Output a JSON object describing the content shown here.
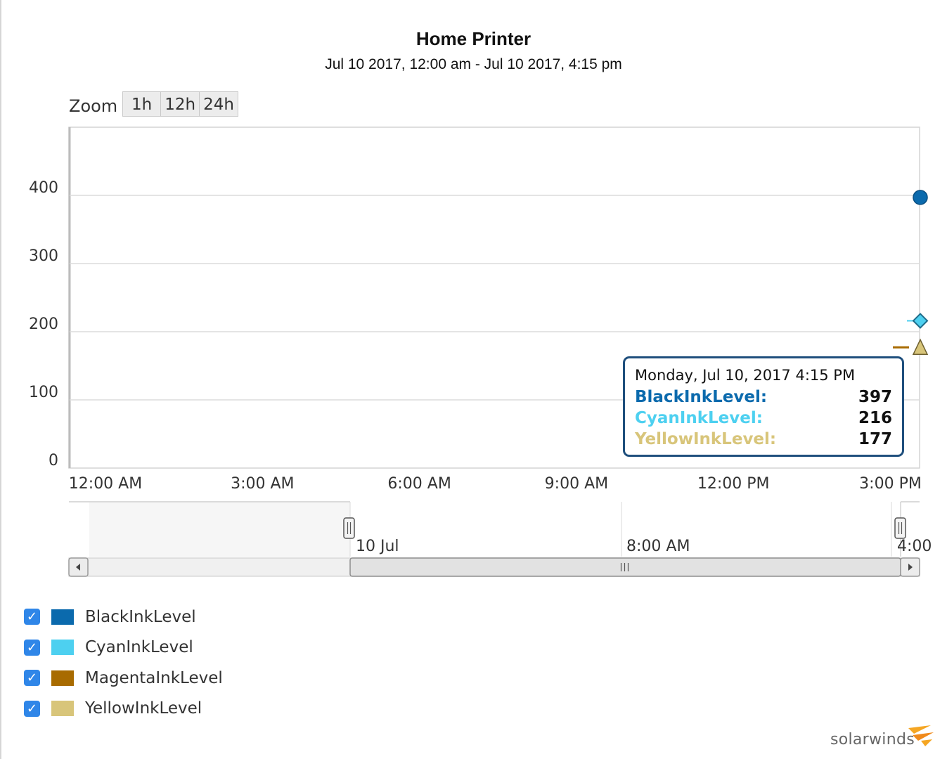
{
  "title": "Home Printer",
  "subtitle": "Jul 10 2017, 12:00 am - Jul 10 2017, 4:15 pm",
  "zoom": {
    "label": "Zoom",
    "buttons": [
      "1h",
      "12h",
      "24h"
    ]
  },
  "chart_data": {
    "type": "line",
    "title": "Home Printer",
    "subtitle": "Jul 10 2017, 12:00 am - Jul 10 2017, 4:15 pm",
    "xlabel": "",
    "ylabel": "",
    "x_range": [
      "12:00 AM",
      "4:15 PM"
    ],
    "x_tick_labels": [
      "12:00 AM",
      "3:00 AM",
      "6:00 AM",
      "9:00 AM",
      "12:00 PM",
      "3:00 PM"
    ],
    "ylim": [
      0,
      400
    ],
    "y_ticks": [
      0,
      100,
      200,
      300,
      400
    ],
    "grid": true,
    "series": [
      {
        "name": "BlackInkLevel",
        "color": "#0b6aad",
        "marker": "circle",
        "points": [
          {
            "x": "4:15 PM",
            "y": 397
          }
        ]
      },
      {
        "name": "CyanInkLevel",
        "color": "#4dd0f0",
        "marker": "diamond",
        "points": [
          {
            "x": "4:15 PM",
            "y": 216
          }
        ]
      },
      {
        "name": "MagentaInkLevel",
        "color": "#a86b00",
        "marker": "dash",
        "points": [
          {
            "x": "4:15 PM",
            "y": 177
          }
        ]
      },
      {
        "name": "YellowInkLevel",
        "color": "#d8c57a",
        "marker": "triangle",
        "points": [
          {
            "x": "4:15 PM",
            "y": 177
          }
        ]
      }
    ],
    "navigator": {
      "labels": [
        "10 Jul",
        "8:00 AM",
        "4:00"
      ]
    },
    "tooltip": {
      "date": "Monday, Jul 10, 2017 4:15 PM",
      "rows": [
        {
          "name": "BlackInkLevel:",
          "value": "397",
          "color": "#0b6aad"
        },
        {
          "name": "CyanInkLevel:",
          "value": "216",
          "color": "#4dd0f0"
        },
        {
          "name": "YellowInkLevel:",
          "value": "177",
          "color": "#d8c57a"
        }
      ]
    }
  },
  "legend": [
    {
      "label": "BlackInkLevel",
      "color": "#0b6aad",
      "checked": true
    },
    {
      "label": "CyanInkLevel",
      "color": "#4dd0f0",
      "checked": true
    },
    {
      "label": "MagentaInkLevel",
      "color": "#a86b00",
      "checked": true
    },
    {
      "label": "YellowInkLevel",
      "color": "#d8c57a",
      "checked": true
    }
  ],
  "icons": {
    "checkbox": "checkmark-icon"
  },
  "logo": {
    "text": "solarwinds"
  }
}
